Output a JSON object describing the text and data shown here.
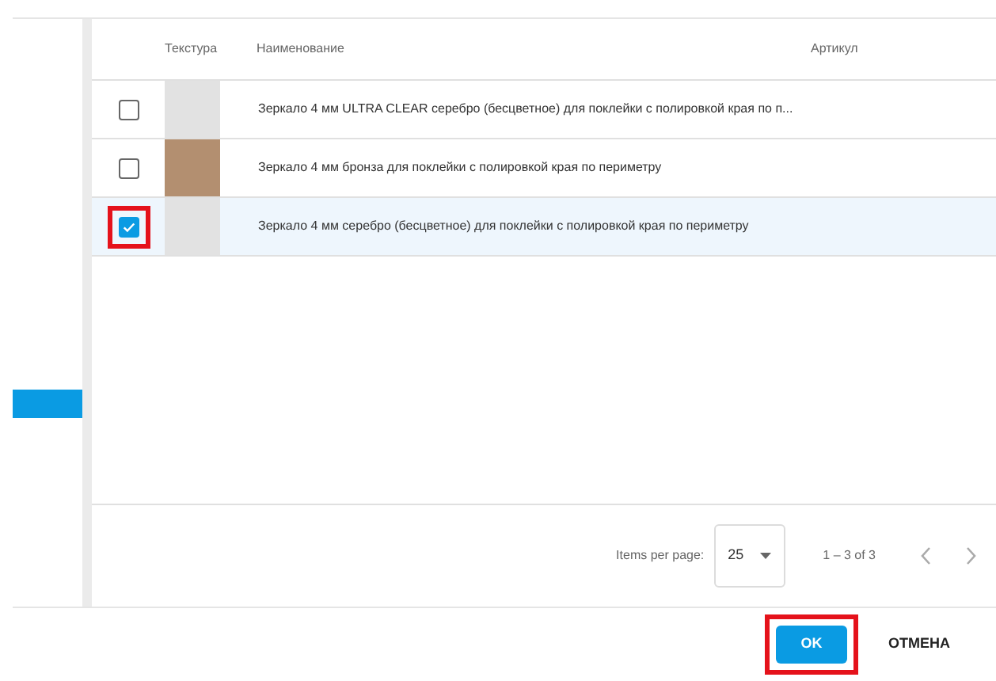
{
  "table": {
    "columns": [
      "Текстура",
      "Наименование",
      "Артикул"
    ],
    "rows": [
      {
        "checked": false,
        "highlighted": false,
        "selected": false,
        "color": "#e2e2e2",
        "name": "Зеркало 4 мм ULTRA CLEAR серебро (бесцветное) для поклейки с полировкой края по п..."
      },
      {
        "checked": false,
        "highlighted": false,
        "selected": false,
        "color": "#b38f70",
        "name": "Зеркало 4 мм бронза для поклейки с полировкой края по периметру"
      },
      {
        "checked": true,
        "highlighted": true,
        "selected": true,
        "color": "#e2e2e2",
        "name": "Зеркало 4 мм серебро (бесцветное) для поклейки с полировкой края по периметру"
      }
    ]
  },
  "paginator": {
    "label": "Items per page:",
    "page_size": "25",
    "range": "1 – 3 of 3"
  },
  "buttons": [
    {
      "kind": "primary",
      "label": "OK",
      "highlighted": true
    },
    {
      "kind": "flat",
      "label": "ОТМЕНА",
      "highlighted": false
    }
  ]
}
